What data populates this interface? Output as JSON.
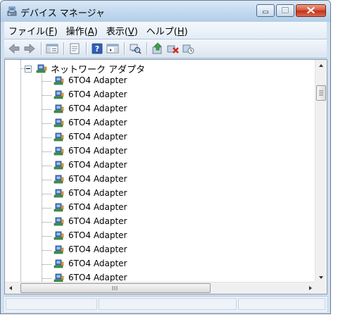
{
  "window": {
    "title": "デバイス マネージャ",
    "title_icon": "device-manager-icon"
  },
  "menu": [
    {
      "name": "menu-file",
      "text": "ファイル(",
      "acc": "F",
      "end": ")"
    },
    {
      "name": "menu-action",
      "text": "操作(",
      "acc": "A",
      "end": ")"
    },
    {
      "name": "menu-view",
      "text": "表示(",
      "acc": "V",
      "end": ")"
    },
    {
      "name": "menu-help",
      "text": "ヘルプ(",
      "acc": "H",
      "end": ")"
    }
  ],
  "toolbar": [
    "back-icon",
    "forward-icon",
    "show-hide-tree-icon",
    "properties-icon",
    "help-icon",
    "show-hide-action-pane-icon",
    "scan-hardware-icon",
    "update-driver-icon",
    "uninstall-device-icon",
    "disable-device-icon"
  ],
  "tree": {
    "root_label": "ネットワーク アダプタ",
    "items": [
      "6TO4 Adapter",
      "6TO4 Adapter",
      "6TO4 Adapter",
      "6TO4 Adapter",
      "6TO4 Adapter",
      "6TO4 Adapter",
      "6TO4 Adapter",
      "6TO4 Adapter",
      "6TO4 Adapter",
      "6TO4 Adapter",
      "6TO4 Adapter",
      "6TO4 Adapter",
      "6TO4 Adapter",
      "6TO4 Adapter",
      "6TO4 Adapter"
    ]
  },
  "colors": {
    "titlebar": "#c6dbef",
    "close_button": "#d4553a",
    "content_bg": "#ffffff"
  }
}
